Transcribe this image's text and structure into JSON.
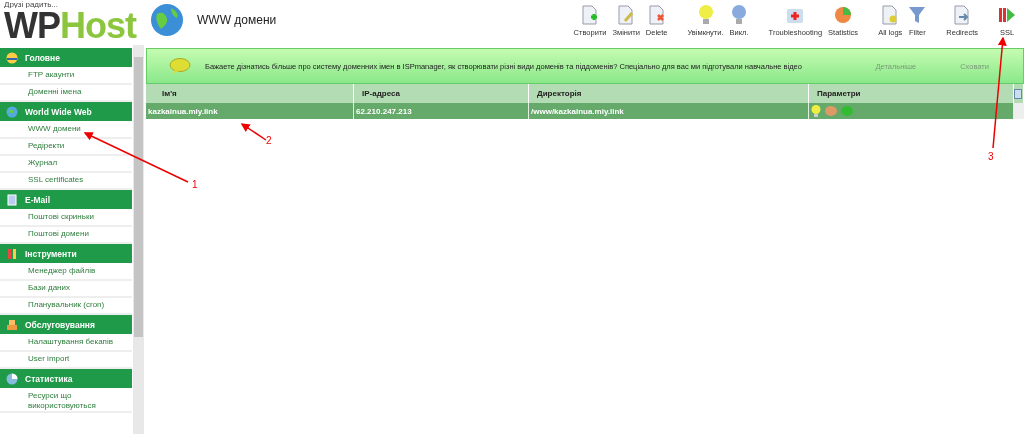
{
  "header": {
    "tagline": "Друзі радить...",
    "logo_dark": "WP",
    "logo_light": "Host",
    "page_title": "WWW домени"
  },
  "toolbar": [
    {
      "label": "Створити",
      "kind": "create"
    },
    {
      "label": "Змінити",
      "kind": "edit"
    },
    {
      "label": "Delete",
      "kind": "delete"
    },
    {
      "label": "Увімкнути.",
      "kind": "on"
    },
    {
      "label": "Викл.",
      "kind": "off"
    },
    {
      "label": "Troubleshooting",
      "kind": "medkit"
    },
    {
      "label": "Statistics",
      "kind": "pie"
    },
    {
      "label": "All logs",
      "kind": "logs"
    },
    {
      "label": "Filter",
      "kind": "filter"
    },
    {
      "label": "Redirects",
      "kind": "redirect"
    },
    {
      "label": "SSL",
      "kind": "ssl"
    }
  ],
  "sidebar": [
    {
      "title": "Головне",
      "kind": "home",
      "items": [
        {
          "label": "FTP акаунти"
        },
        {
          "label": "Доменні імена"
        }
      ]
    },
    {
      "title": "World Wide Web",
      "kind": "globe",
      "items": [
        {
          "label": "WWW домени"
        },
        {
          "label": "Редіректи"
        },
        {
          "label": "Журнал"
        },
        {
          "label": "SSL certificates"
        }
      ]
    },
    {
      "title": "E-Mail",
      "kind": "mail",
      "items": [
        {
          "label": "Поштові скриньки"
        },
        {
          "label": "Поштові домени"
        }
      ]
    },
    {
      "title": "Інструменти",
      "kind": "tools",
      "items": [
        {
          "label": "Менеджер файлів"
        },
        {
          "label": "Бази даних"
        },
        {
          "label": "Планувальник (cron)"
        }
      ]
    },
    {
      "title": "Обслуговування",
      "kind": "boxes",
      "items": [
        {
          "label": "Налаштування бекапів"
        },
        {
          "label": "User import"
        }
      ]
    },
    {
      "title": "Статистика",
      "kind": "pie",
      "items": [
        {
          "label": "Ресурси що використовуються"
        }
      ]
    }
  ],
  "banner": {
    "text": "Бажаете дізнатись більше про систему доменних імен в ISPmanager, як створювати різні види доменів та піддоменів? Спеціально для вас ми підготували навчальне відео",
    "more_link": "Детальніше",
    "hide_link": "Сховати"
  },
  "table": {
    "columns": [
      "Ім'я",
      "IP-адреса",
      "Директорія",
      "Параметри"
    ],
    "rows": [
      {
        "name": "kazkainua.miy.link",
        "ip": "62.210.247.213",
        "directory": "/www/kazkainua.miy.link",
        "selected": true,
        "params": [
          {
            "kind": "bulb"
          },
          {
            "kind": "ssi"
          },
          {
            "kind": "php"
          }
        ]
      }
    ]
  },
  "annotations": [
    {
      "label": "1"
    },
    {
      "label": "2"
    },
    {
      "label": "3"
    }
  ]
}
